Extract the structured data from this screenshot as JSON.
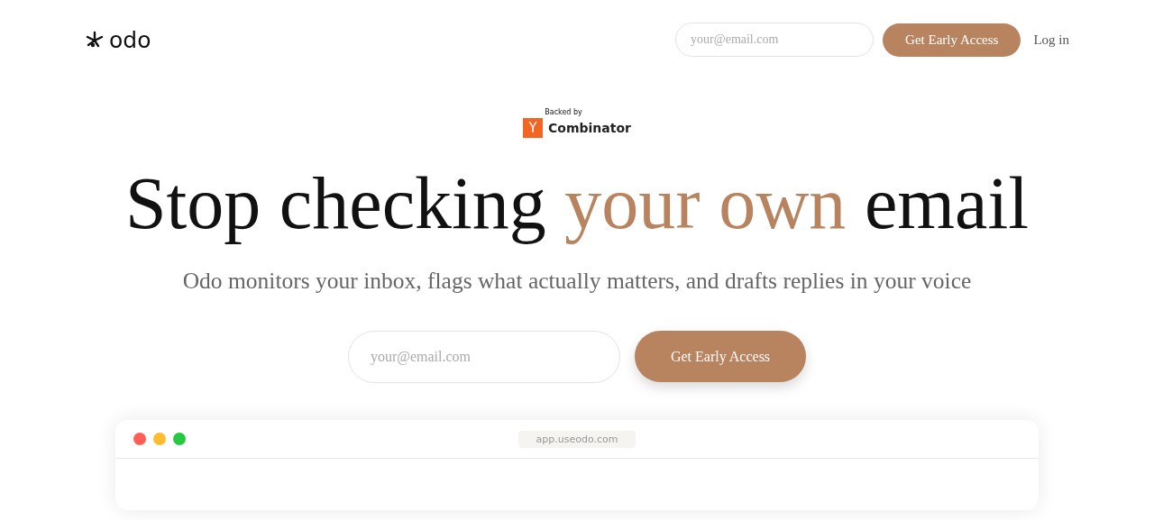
{
  "header": {
    "logo": "odo",
    "email_placeholder": "your@email.com",
    "cta": "Get Early Access",
    "login": "Log in"
  },
  "badge": {
    "backed_by": "Backed by",
    "mark": "Y",
    "name": "Combinator"
  },
  "headline": [
    {
      "text": "Stop checking ",
      "accent": false
    },
    {
      "text": "your own",
      "accent": true
    },
    {
      "text": " email",
      "accent": false
    }
  ],
  "subtitle": "Odo monitors your inbox, flags what actually matters, and drafts replies in your voice",
  "signup": {
    "email_placeholder": "your@email.com",
    "cta": "Get Early Access"
  },
  "browser": {
    "dots": [
      {
        "color": "#ff5f57"
      },
      {
        "color": "#febc2e"
      },
      {
        "color": "#28c840"
      }
    ],
    "url": "app.useodo.com"
  }
}
